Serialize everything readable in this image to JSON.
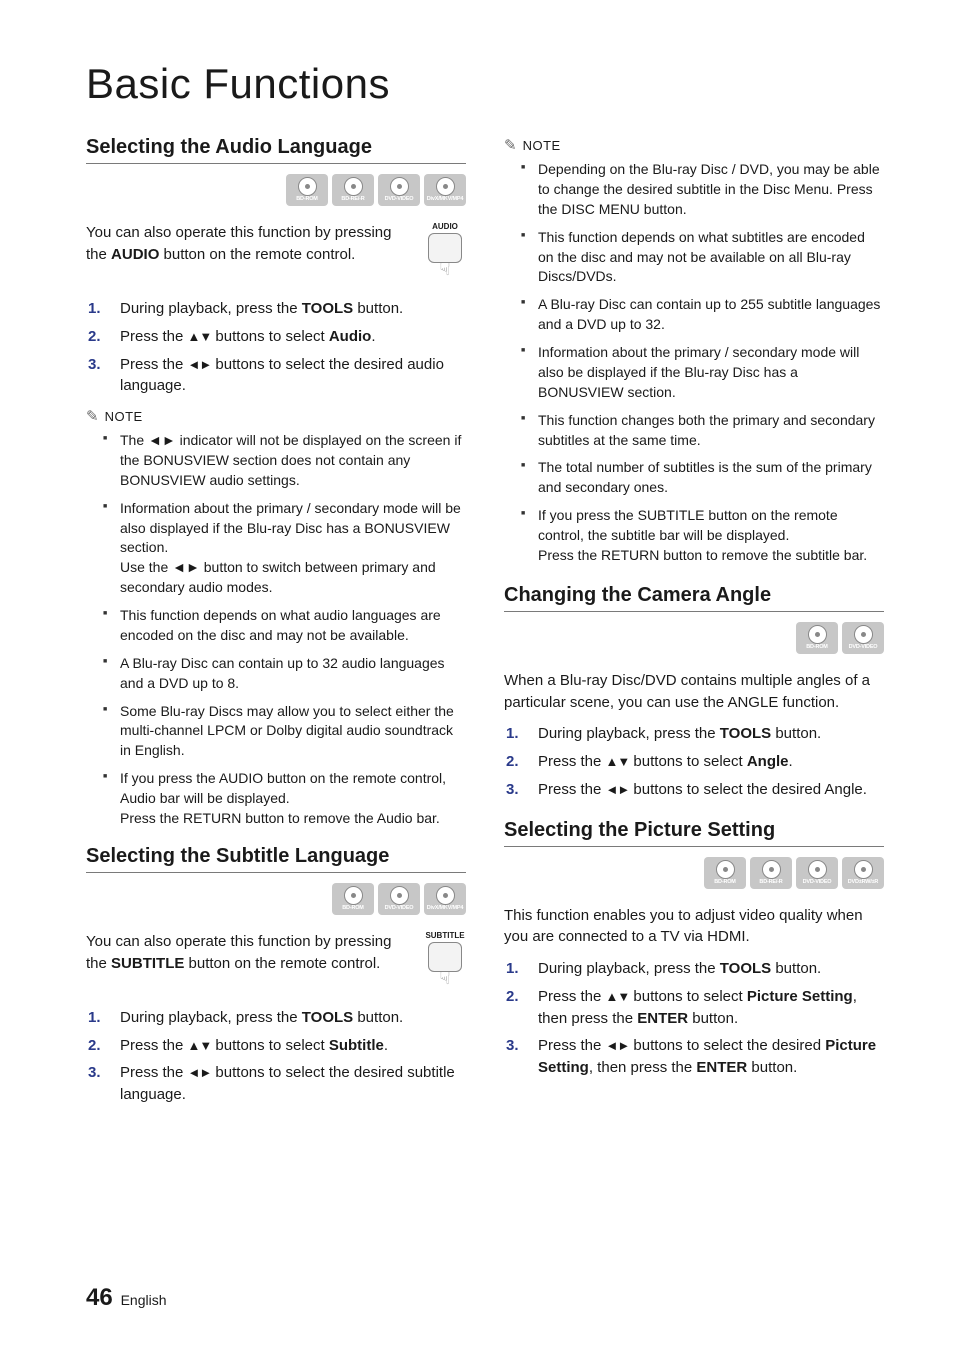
{
  "title": "Basic Functions",
  "disc_labels": {
    "bd_rom": "BD-ROM",
    "bd_re_r": "BD-RE/-R",
    "dvd_video": "DVD-VIDEO",
    "divx": "DivX/MKV/MP4",
    "dvd_rw_r": "DVD±RW/±R"
  },
  "audio_lang": {
    "heading": "Selecting the Audio Language",
    "remote_btn_label": "AUDIO",
    "intro_1": "You can also operate this function by pressing the ",
    "intro_bold": "AUDIO",
    "intro_2": " button on the remote control.",
    "steps": [
      {
        "pre": "During playback, press the ",
        "bold1": "TOOLS",
        "post": " button."
      },
      {
        "pre": "Press the ",
        "arrows": "▲▼",
        "mid": " buttons to select ",
        "bold1": "Audio",
        "post": "."
      },
      {
        "pre": "Press the ",
        "arrows": "◄►",
        "mid": " buttons to select the desired audio language.",
        "bold1": "",
        "post": ""
      }
    ],
    "note_label": "NOTE",
    "notes": [
      "The ◄► indicator will not be displayed on the screen if the BONUSVIEW section does not contain any BONUSVIEW audio settings.",
      "Information about the primary / secondary mode will be also displayed if the Blu-ray Disc has a BONUSVIEW section.\nUse the ◄► button to switch between primary and secondary audio modes.",
      "This function depends on what audio languages are encoded on the disc and may not be available.",
      "A Blu-ray Disc can contain up to 32 audio languages and a DVD up to 8.",
      "Some Blu-ray Discs may allow you to select either the multi-channel LPCM or Dolby digital audio soundtrack in English.",
      "If you press the AUDIO button on the remote control, Audio bar will be displayed.\nPress the RETURN button to remove the Audio bar."
    ]
  },
  "subtitle_lang": {
    "heading": "Selecting the Subtitle Language",
    "remote_btn_label": "SUBTITLE",
    "intro_1": "You can also operate this function by pressing the ",
    "intro_bold": "SUBTITLE",
    "intro_2": " button on the remote control.",
    "steps": [
      {
        "pre": "During playback, press the ",
        "bold1": "TOOLS",
        "post": " button."
      },
      {
        "pre": "Press the ",
        "arrows": "▲▼",
        "mid": " buttons to select ",
        "bold1": "Subtitle",
        "post": "."
      },
      {
        "pre": "Press the ",
        "arrows": "◄►",
        "mid": " buttons to select the desired subtitle language.",
        "bold1": "",
        "post": ""
      }
    ],
    "note_label": "NOTE",
    "notes": [
      "Depending on the Blu-ray Disc / DVD, you may be able to change the desired subtitle in the Disc Menu. Press the DISC MENU button.",
      "This function depends on what subtitles are encoded on the disc and may not be available on all Blu-ray Discs/DVDs.",
      "A Blu-ray Disc can contain up to 255 subtitle languages and a DVD up to 32.",
      "Information about the primary / secondary mode will also be displayed if the Blu-ray Disc has a BONUSVIEW section.",
      "This function changes both the primary and secondary subtitles at the same time.",
      "The total number of subtitles is the sum of the primary and secondary ones.",
      "If you press the SUBTITLE button on the remote control, the subtitle bar will be displayed.\nPress the RETURN button to remove the subtitle bar."
    ]
  },
  "camera_angle": {
    "heading": "Changing the Camera Angle",
    "intro": "When a Blu-ray Disc/DVD contains multiple angles of a particular scene, you can use the ANGLE function.",
    "steps": [
      {
        "pre": "During playback, press the ",
        "bold1": "TOOLS",
        "post": " button."
      },
      {
        "pre": "Press the ",
        "arrows": "▲▼",
        "mid": " buttons to select ",
        "bold1": "Angle",
        "post": "."
      },
      {
        "pre": "Press the ",
        "arrows": "◄►",
        "mid": " buttons to select the desired Angle.",
        "bold1": "",
        "post": ""
      }
    ]
  },
  "picture_setting": {
    "heading": "Selecting the Picture Setting",
    "intro": "This function enables you to adjust video quality when you are connected to a TV via HDMI.",
    "steps": [
      {
        "pre": "During playback, press the ",
        "bold1": "TOOLS",
        "post": " button."
      },
      {
        "pre": "Press the ",
        "arrows": "▲▼",
        "mid": " buttons to select ",
        "bold1": "Picture Setting",
        "post": ", then press the ",
        "bold2": "ENTER",
        "post2": " button."
      },
      {
        "pre": "Press the ",
        "arrows": "◄►",
        "mid": " buttons to select the desired ",
        "bold1": "Picture Setting",
        "post": ", then press the ",
        "bold2": "ENTER",
        "post2": " button."
      }
    ]
  },
  "footer": {
    "page_number": "46",
    "language": "English"
  }
}
